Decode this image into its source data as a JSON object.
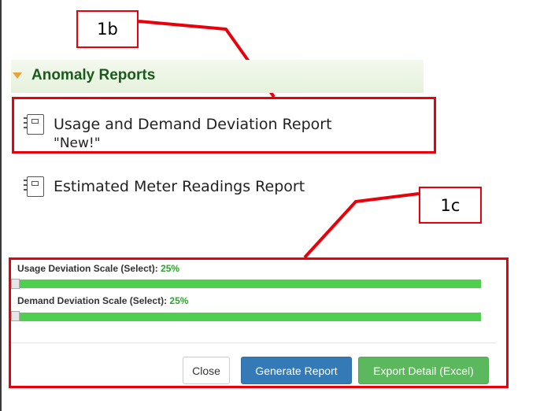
{
  "callouts": {
    "c1b": "1b",
    "c1c": "1c"
  },
  "section": {
    "title": "Anomaly Reports"
  },
  "reports": [
    {
      "label": "Usage and Demand Deviation Report",
      "sublabel": "\"New!\""
    },
    {
      "label": "Estimated Meter Readings Report"
    }
  ],
  "scales": {
    "usage": {
      "label": "Usage Deviation Scale (Select):",
      "value": "25%"
    },
    "demand": {
      "label": "Demand Deviation Scale (Select):",
      "value": "25%"
    }
  },
  "buttons": {
    "close": "Close",
    "generate": "Generate Report",
    "export": "Export Detail (Excel)"
  },
  "colors": {
    "accent_red": "#e8000b",
    "header_green": "#1a5a1a",
    "scale_green": "#4ecf4e",
    "primary_blue": "#337ab7",
    "success_green": "#5cb85c"
  }
}
